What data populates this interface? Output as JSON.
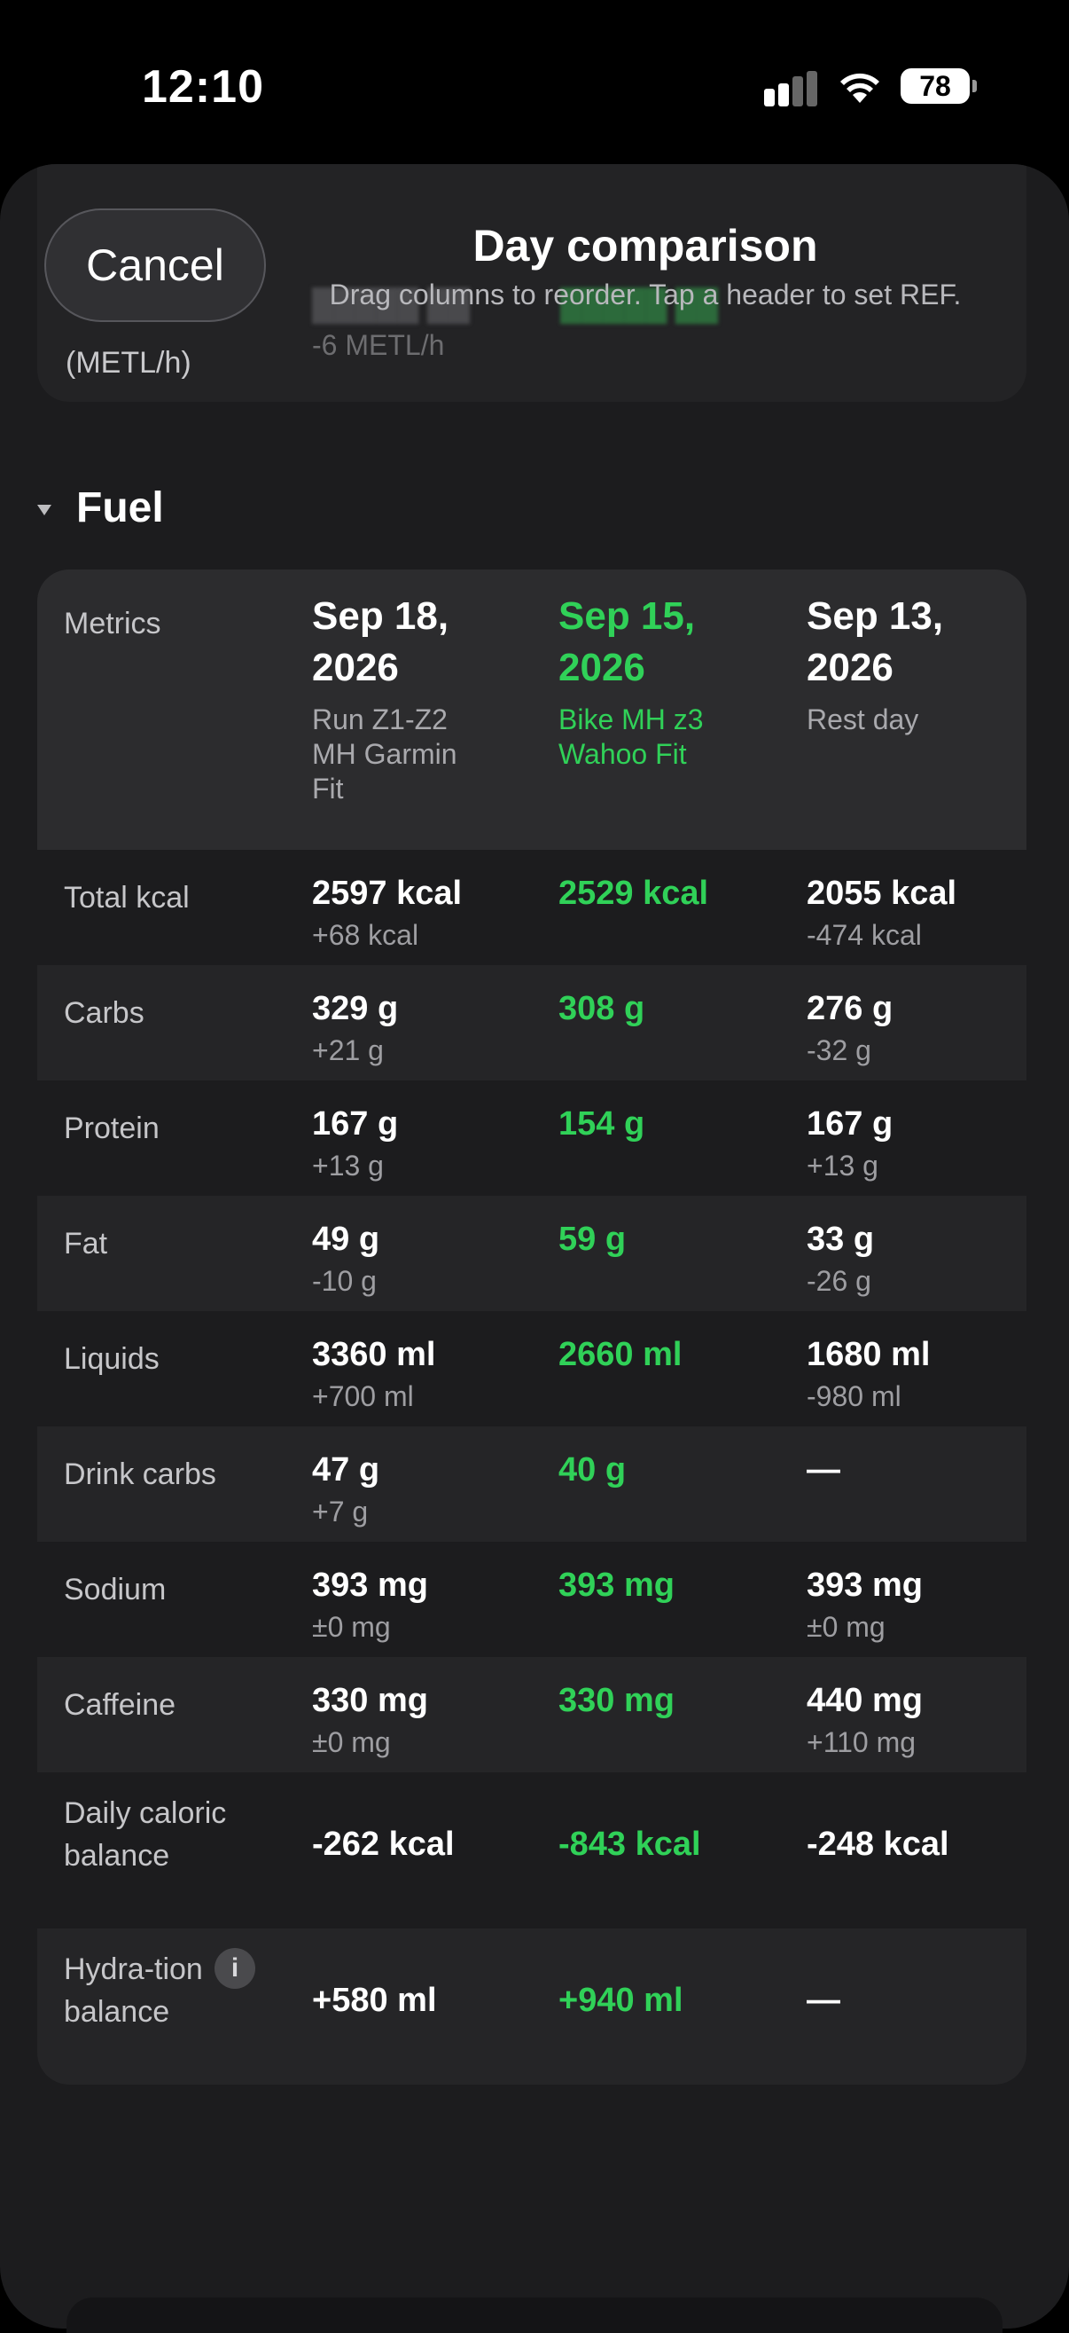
{
  "status_bar": {
    "time": "12:10",
    "battery": "78"
  },
  "ghost_row": {
    "label": "(METL/h)",
    "delta": "-6 METL/h"
  },
  "header": {
    "cancel_label": "Cancel",
    "title": "Day comparison",
    "subtitle": "Drag columns to reorder. Tap a header to set REF."
  },
  "section": {
    "title": "Fuel"
  },
  "columns": {
    "metrics_label": "Metrics",
    "items": [
      {
        "date": "Sep 18, 2026",
        "activity": "Run Z1-Z2 MH Garmin Fit"
      },
      {
        "date": "Sep 15, 2026",
        "activity": "Bike MH z3 Wahoo Fit"
      },
      {
        "date": "Sep 13, 2026",
        "activity": "Rest day"
      }
    ],
    "ref_color": "#30d158"
  },
  "rows": [
    {
      "metric": "Total kcal",
      "c1": "2597 kcal",
      "d1": "+68 kcal",
      "c2": "2529 kcal",
      "c3": "2055 kcal",
      "d3": "-474 kcal"
    },
    {
      "metric": "Carbs",
      "c1": "329 g",
      "d1": "+21 g",
      "c2": "308 g",
      "c3": "276 g",
      "d3": "-32 g"
    },
    {
      "metric": "Protein",
      "c1": "167 g",
      "d1": "+13 g",
      "c2": "154 g",
      "c3": "167 g",
      "d3": "+13 g"
    },
    {
      "metric": "Fat",
      "c1": "49 g",
      "d1": "-10 g",
      "c2": "59 g",
      "c3": "33 g",
      "d3": "-26 g"
    },
    {
      "metric": "Liquids",
      "c1": "3360 ml",
      "d1": "+700 ml",
      "c2": "2660 ml",
      "c3": "1680 ml",
      "d3": "-980 ml"
    },
    {
      "metric": "Drink carbs",
      "c1": "47 g",
      "d1": "+7 g",
      "c2": "40 g",
      "c3": "—",
      "d3": ""
    },
    {
      "metric": "Sodium",
      "c1": "393 mg",
      "d1": "±0 mg",
      "c2": "393 mg",
      "c3": "393 mg",
      "d3": "±0 mg"
    },
    {
      "metric": "Caffeine",
      "c1": "330 mg",
      "d1": "±0 mg",
      "c2": "330 mg",
      "c3": "440 mg",
      "d3": "+110 mg"
    },
    {
      "metric": "Daily caloric balance",
      "c1": "-262 kcal",
      "d1": "",
      "c2": "-843 kcal",
      "c3": "-248 kcal",
      "d3": ""
    },
    {
      "metric": "Hydra-tion balance",
      "c1": "+580 ml",
      "d1": "",
      "c2": "+940 ml",
      "c3": "—",
      "d3": "",
      "info_icon": "i"
    }
  ]
}
